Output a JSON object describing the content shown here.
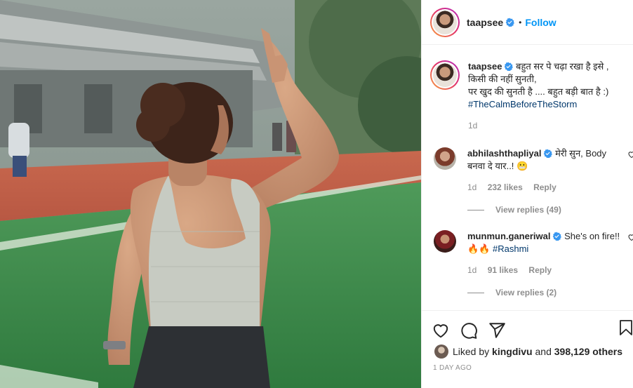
{
  "post": {
    "username": "taapsee",
    "follow_label": "Follow",
    "dot": "•"
  },
  "caption": {
    "username": "taapsee",
    "line1": "बहुत सर पे चढ़ा रखा है इसे ,",
    "line2": "किसी की नहीं सुनती,",
    "line3": "पर खुद की सुनती है .... बहुत बड़ी बात है :)",
    "hashtag": "#TheCalmBeforeTheStorm",
    "age": "1d"
  },
  "comments": [
    {
      "username": "abhilashthapliyal",
      "text": "मेरी सुन, Body बनवा दे यार..! 😬",
      "age": "1d",
      "likes": "232 likes",
      "reply": "Reply",
      "view_replies": "View replies (49)"
    },
    {
      "username": "munmun.ganeriwal",
      "text_before": "She's on fire!!🔥🔥",
      "hashtag": "#Rashmi",
      "age": "1d",
      "likes": "91 likes",
      "reply": "Reply",
      "view_replies": "View replies (2)"
    }
  ],
  "footer": {
    "liked_prefix": "Liked by",
    "liked_user": "kingdivu",
    "liked_and": "and",
    "liked_others": "398,129 others",
    "date": "1 DAY AGO"
  },
  "icons": {
    "like": "heart-icon",
    "comment": "comment-icon",
    "share": "paper-plane-icon",
    "save": "bookmark-icon",
    "verified": "verified-badge-icon"
  },
  "colors": {
    "link": "#0095f6",
    "hashtag": "#00376b",
    "muted": "#8e8e8e",
    "verified": "#3897f0"
  }
}
